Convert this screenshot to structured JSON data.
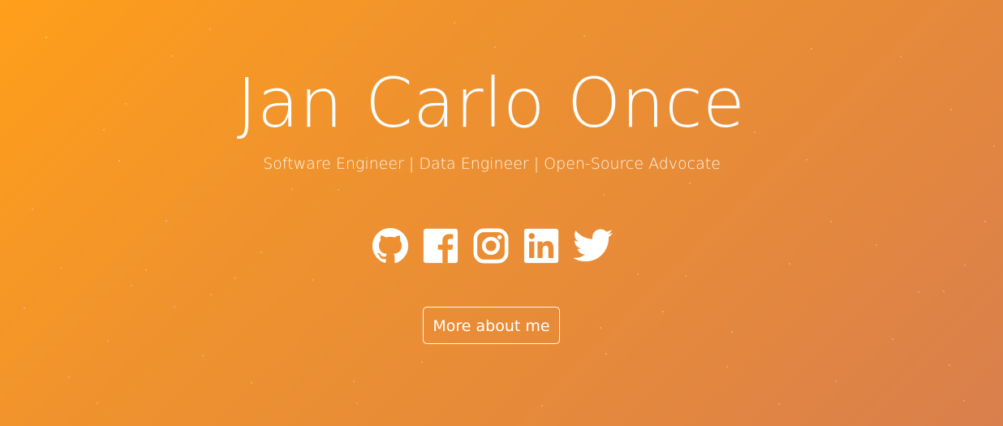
{
  "hero": {
    "name": "Jan Carlo Once",
    "tagline": "Software Engineer | Data Engineer | Open-Source Advocate",
    "button_label": "More about me",
    "colors": {
      "gradient_start": "#ff9f1a",
      "gradient_end": "#d97f4d",
      "text": "#ffffff"
    }
  },
  "socials": [
    {
      "icon": "github-icon",
      "name": "GitHub"
    },
    {
      "icon": "facebook-icon",
      "name": "Facebook"
    },
    {
      "icon": "instagram-icon",
      "name": "Instagram"
    },
    {
      "icon": "linkedin-icon",
      "name": "LinkedIn"
    },
    {
      "icon": "twitter-icon",
      "name": "Twitter"
    }
  ]
}
